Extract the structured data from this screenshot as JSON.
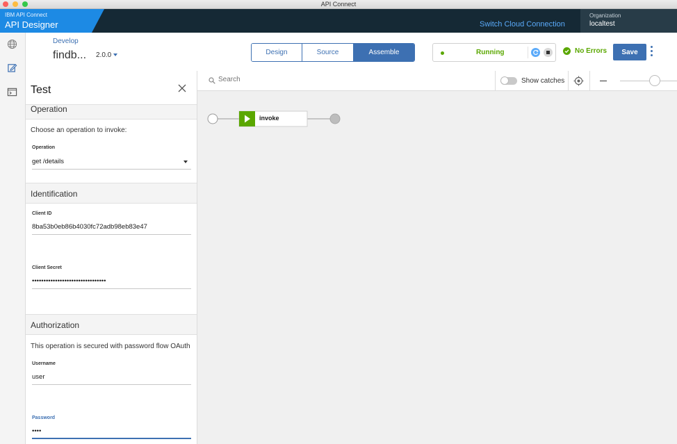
{
  "window": {
    "title": "API Connect"
  },
  "header": {
    "brand_small": "IBM API Connect",
    "brand_title": "API Designer",
    "switch_connection": "Switch Cloud Connection",
    "org_label": "Organization",
    "org_value": "localtest"
  },
  "toolbar": {
    "breadcrumb": "Develop",
    "api_name": "findb...",
    "version": "2.0.0",
    "tabs": [
      {
        "label": "Design",
        "width": 73
      },
      {
        "label": "Source",
        "width": 74
      },
      {
        "label": "Assemble",
        "width": 87
      }
    ],
    "status": "Running",
    "errors": "No Errors",
    "save_label": "Save"
  },
  "test_panel": {
    "title": "Test",
    "operation": {
      "section": "Operation",
      "prompt": "Choose an operation to invoke:",
      "label": "Operation",
      "value": "get /details"
    },
    "identification": {
      "section": "Identification",
      "client_id_label": "Client ID",
      "client_id_value": "8ba53b0eb86b4030fc72adb98eb83e47",
      "client_secret_label": "Client Secret",
      "client_secret_value": "••••••••••••••••••••••••••••••••"
    },
    "authorization": {
      "section": "Authorization",
      "note": "This operation is secured with password flow OAuth",
      "username_label": "Username",
      "username_value": "user",
      "password_label": "Password",
      "password_value": "••••"
    }
  },
  "assemble": {
    "search_placeholder": "Search",
    "show_catches": "Show catches",
    "node_label": "invoke"
  },
  "colors": {
    "header_bg": "#152935",
    "brand_blue": "#1d8ae4",
    "accent": "#3d70b2",
    "success": "#5aa700",
    "invoke_green": "#5aa700"
  }
}
